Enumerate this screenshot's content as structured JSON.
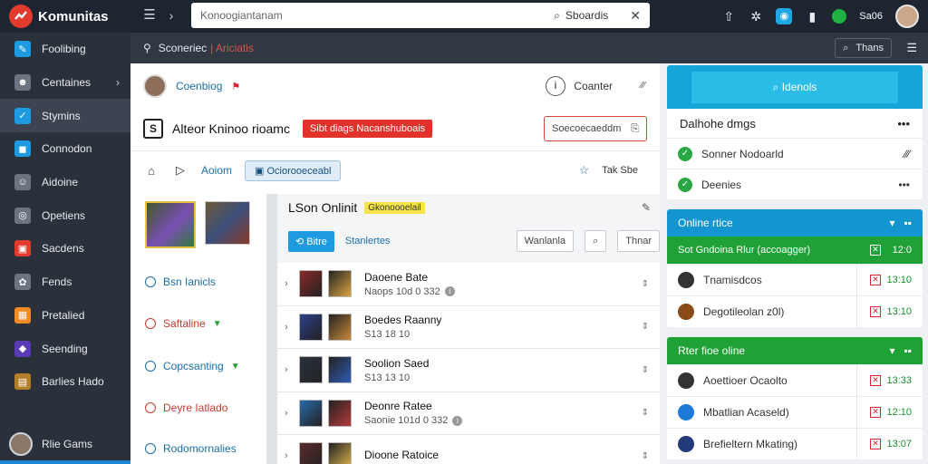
{
  "app": {
    "name": "Komunitas"
  },
  "topbar": {
    "search_text": "Konoogiantanam",
    "search_scope": "Sboardis",
    "user": "Sa06"
  },
  "sidebar": {
    "items": [
      {
        "label": "Foolibing",
        "color": "#1e9be0"
      },
      {
        "label": "Centaines",
        "color": "#6b7480",
        "chevron": true
      },
      {
        "label": "Stymins",
        "color": "#1e9be0",
        "active": true
      },
      {
        "label": "Connodon",
        "color": "#1e9be0"
      },
      {
        "label": "Aidoine",
        "color": "#6b7480"
      },
      {
        "label": "Opetiens",
        "color": "#6b7480"
      },
      {
        "label": "Sacdens",
        "color": "#e23b2e"
      },
      {
        "label": "Fends",
        "color": "#6b7480"
      },
      {
        "label": "Pretalied",
        "color": "#f08a24"
      },
      {
        "label": "Seending",
        "color": "#5a3bb3"
      },
      {
        "label": "Barlies Hado",
        "color": "#b3802a"
      }
    ],
    "user": "Rlie Gams"
  },
  "subheader": {
    "title": "Sconeriec",
    "accent": "| Ariciatis",
    "button": "Thans"
  },
  "main": {
    "author": "Coenbiog",
    "counter": "Coanter",
    "counter_more": "⁄⁄⁄",
    "title": "Alteor Kninoo rioamc",
    "red_button": "Sibt diags Nacanshuboais",
    "search": "Soecoecaeddm",
    "tabs": {
      "first": "Aoiom",
      "active": "Ociorooeceabl"
    },
    "tools": "Tak Sbe",
    "left_items": [
      {
        "label": "Bsn Ianicls",
        "color": "#1a6fa8"
      },
      {
        "label": "Saftaline",
        "color": "#c23b2e",
        "caret": "#2a9d3a"
      },
      {
        "label": "Copcsanting",
        "color": "#1a6fa8",
        "caret": "#2a9d3a"
      },
      {
        "label": "Deyre Iatlado",
        "color": "#c23b2e"
      },
      {
        "label": "Rodomornalies",
        "color": "#1a6fa8"
      }
    ],
    "list": {
      "title": "LSon Onlinit",
      "badge": "Gkonoooelail",
      "primary_btn": "Bitre",
      "secondary": "Stanlertes",
      "box1": "Wanlanla",
      "box2": "Thnar",
      "rows": [
        {
          "title": "Daoene Bate",
          "sub": "Naops 10d 0 332",
          "info": true
        },
        {
          "title": "Boedes Raanny",
          "sub": "S13 18 10"
        },
        {
          "title": "Soolion Saed",
          "sub": "S13 13 10"
        },
        {
          "title": "Deonre Ratee",
          "sub": "Saonie 101d 0 332",
          "info": true
        },
        {
          "title": "Dioone Ratoice",
          "sub": ""
        }
      ]
    }
  },
  "right": {
    "banner": "Idenols",
    "card1": {
      "title": "Dalhohe dmgs",
      "rows": [
        {
          "label": "Sonner Nodoarld"
        },
        {
          "label": "Deenies"
        }
      ]
    },
    "card2": {
      "title": "Online rtice",
      "green": "Sot Gndoina Rlur (accoagger)",
      "green_time": "12:0",
      "items": [
        {
          "label": "Tnamisdcos",
          "time": "13:10",
          "color": "#333"
        },
        {
          "label": "Degotileolan z0l)",
          "time": "13:10",
          "color": "#8a4a1a"
        }
      ]
    },
    "card3": {
      "title": "Rter fioe oline",
      "items": [
        {
          "label": "Aoettioer Ocaolto",
          "time": "13:33",
          "color": "#333"
        },
        {
          "label": "Mbatlian Acaseld)",
          "time": "12:10",
          "color": "#1e7ad6"
        },
        {
          "label": "Brefieltern Mkating)",
          "time": "13:07",
          "color": "#233a7a"
        }
      ]
    }
  }
}
